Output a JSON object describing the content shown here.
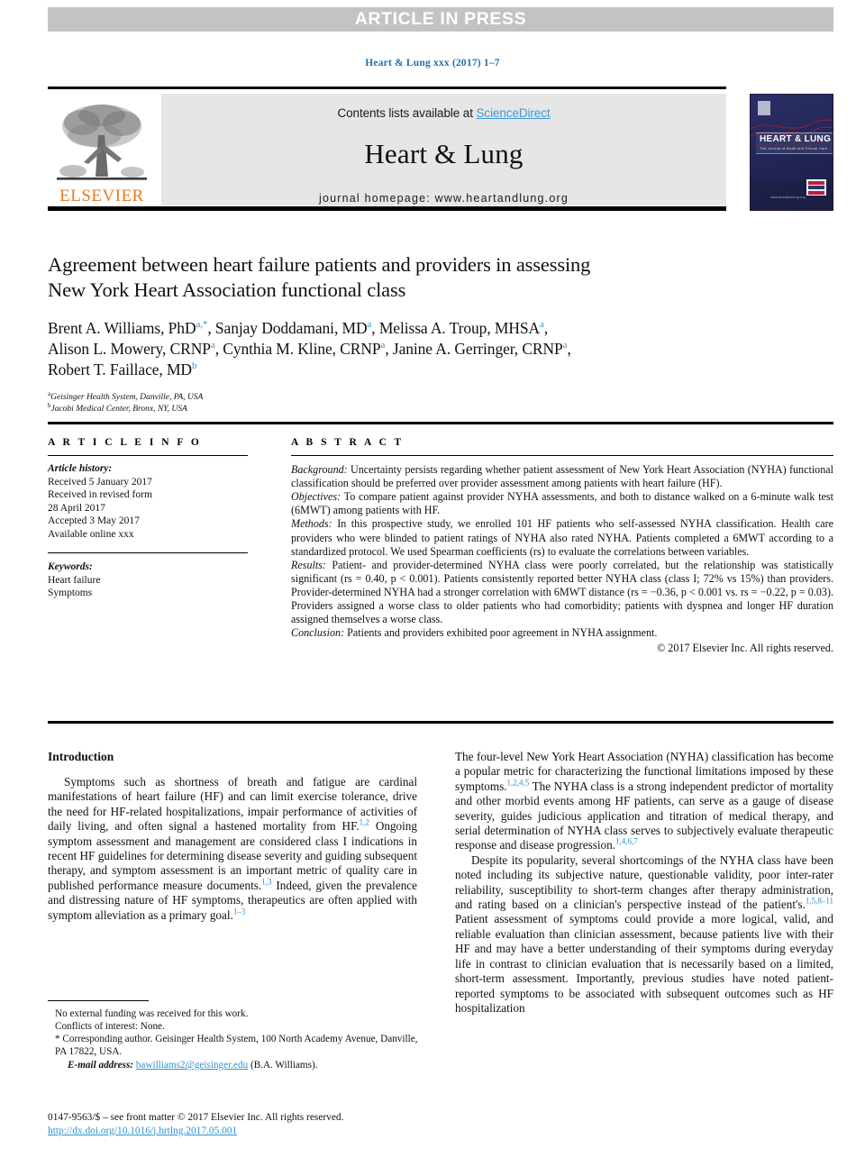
{
  "banner": {
    "text": "ARTICLE IN PRESS"
  },
  "running_head": "Heart & Lung xxx (2017) 1–7",
  "masthead": {
    "contents_prefix": "Contents lists available at ",
    "sciencedirect": "ScienceDirect",
    "journal_name": "Heart & Lung",
    "homepage": "journal homepage: www.heartandlung.org",
    "publisher": "ELSEVIER",
    "cover": {
      "title": "HEART & LUNG",
      "subtitle": "The Journal of Acute and Critical Care",
      "url": "www.heartandlung.org"
    }
  },
  "article": {
    "title": "Agreement between heart failure patients and providers in assessing New York Heart Association functional class",
    "title_line1": "Agreement between heart failure patients and providers in assessing",
    "title_line2": "New York Heart Association functional class",
    "authors_line1_a": "Brent A. Williams, PhD",
    "authors_line1_a_sup": "a,*",
    "authors_line1_b": ", Sanjay Doddamani, MD",
    "authors_line1_b_sup": "a",
    "authors_line1_c": ", Melissa A. Troup, MHSA",
    "authors_line1_c_sup": "a",
    "authors_line1_tail": ",",
    "authors_line2_a": "Alison L. Mowery, CRNP",
    "authors_line2_a_sup": "a",
    "authors_line2_b": ", Cynthia M. Kline, CRNP",
    "authors_line2_b_sup": "a",
    "authors_line2_c": ", Janine A. Gerringer, CRNP",
    "authors_line2_c_sup": "a",
    "authors_line2_tail": ",",
    "authors_line3": "Robert T. Faillace, MD",
    "authors_line3_sup": "b",
    "affiliations": [
      {
        "marker": "a",
        "text": "Geisinger Health System, Danville, PA, USA"
      },
      {
        "marker": "b",
        "text": "Jacobi Medical Center, Bronx, NY, USA"
      }
    ]
  },
  "article_info": {
    "heading": "A R T I C L E   I N F O",
    "history_label": "Article history:",
    "history": [
      "Received 5 January 2017",
      "Received in revised form",
      "28 April 2017",
      "Accepted 3 May 2017",
      "Available online xxx"
    ],
    "keywords_label": "Keywords:",
    "keywords": [
      "Heart failure",
      "Symptoms"
    ]
  },
  "abstract": {
    "heading": "A B S T R A C T",
    "sections": [
      {
        "label": "Background:",
        "text": " Uncertainty persists regarding whether patient assessment of New York Heart Association (NYHA) functional classification should be preferred over provider assessment among patients with heart failure (HF)."
      },
      {
        "label": "Objectives:",
        "text": " To compare patient against provider NYHA assessments, and both to distance walked on a 6-minute walk test (6MWT) among patients with HF."
      },
      {
        "label": "Methods:",
        "text": " In this prospective study, we enrolled 101 HF patients who self-assessed NYHA classification. Health care providers who were blinded to patient ratings of NYHA also rated NYHA. Patients completed a 6MWT according to a standardized protocol. We used Spearman coefficients (rs) to evaluate the correlations between variables."
      },
      {
        "label": "Results:",
        "text": " Patient- and provider-determined NYHA class were poorly correlated, but the relationship was statistically significant (rs = 0.40, p < 0.001). Patients consistently reported better NYHA class (class I; 72% vs 15%) than providers. Provider-determined NYHA had a stronger correlation with 6MWT distance (rs = −0.36, p < 0.001 vs. rs = −0.22, p = 0.03). Providers assigned a worse class to older patients who had comorbidity; patients with dyspnea and longer HF duration assigned themselves a worse class."
      },
      {
        "label": "Conclusion:",
        "text": " Patients and providers exhibited poor agreement in NYHA assignment."
      }
    ],
    "copyright": "© 2017 Elsevier Inc. All rights reserved."
  },
  "body": {
    "intro_heading": "Introduction",
    "left_paragraphs": [
      {
        "chunks": [
          {
            "t": "Symptoms such as shortness of breath and fatigue are cardinal manifestations of heart failure (HF) and can limit exercise tolerance, drive the need for HF-related hospitalizations, impair performance of activities of daily living, and often signal a hastened mortality from HF."
          },
          {
            "t": "1,2",
            "sup": true
          },
          {
            "t": " Ongoing symptom assessment and management are considered class I indications in recent HF guidelines for determining disease severity and guiding subsequent therapy, and symptom assessment is an important metric of quality care in published performance measure documents."
          },
          {
            "t": "1,3",
            "sup": true
          },
          {
            "t": " Indeed, given the prevalence and distressing nature of HF symptoms, therapeutics are often applied with symptom alleviation as a primary goal."
          },
          {
            "t": "1–3",
            "sup": true
          }
        ]
      }
    ],
    "right_paragraphs": [
      {
        "indent": false,
        "chunks": [
          {
            "t": "The four-level New York Heart Association (NYHA) classification has become a popular metric for characterizing the functional limitations imposed by these symptoms."
          },
          {
            "t": "1,2,4,5",
            "sup": true
          },
          {
            "t": " The NYHA class is a strong independent predictor of mortality and other morbid events among HF patients, can serve as a gauge of disease severity, guides judicious application and titration of medical therapy, and serial determination of NYHA class serves to subjectively evaluate therapeutic response and disease progression."
          },
          {
            "t": "1,4,6,7",
            "sup": true
          }
        ]
      },
      {
        "indent": true,
        "chunks": [
          {
            "t": "Despite its popularity, several shortcomings of the NYHA class have been noted including its subjective nature, questionable validity, poor inter-rater reliability, susceptibility to short-term changes after therapy administration, and rating based on a clinician's perspective instead of the patient's."
          },
          {
            "t": "1,5,8–11",
            "sup": true
          },
          {
            "t": " Patient assessment of symptoms could provide a more logical, valid, and reliable evaluation than clinician assessment, because patients live with their HF and may have a better understanding of their symptoms during everyday life in contrast to clinician evaluation that is necessarily based on a limited, short-term assessment. Importantly, previous studies have noted patient-reported symptoms to be associated with subsequent outcomes such as HF hospitalization"
          }
        ]
      }
    ]
  },
  "footnotes": {
    "funding": "No external funding was received for this work.",
    "conflicts": "Conflicts of interest: None.",
    "corresponding": "* Corresponding author. Geisinger Health System, 100 North Academy Avenue, Danville, PA 17822, USA.",
    "email_label": "E-mail address:",
    "email": "bawilliams2@geisinger.edu",
    "email_attrib": "(B.A. Williams).",
    "issn_line": "0147-9563/$ – see front matter © 2017 Elsevier Inc. All rights reserved.",
    "doi": "http://dx.doi.org/10.1016/j.hrtlng.2017.05.001"
  }
}
